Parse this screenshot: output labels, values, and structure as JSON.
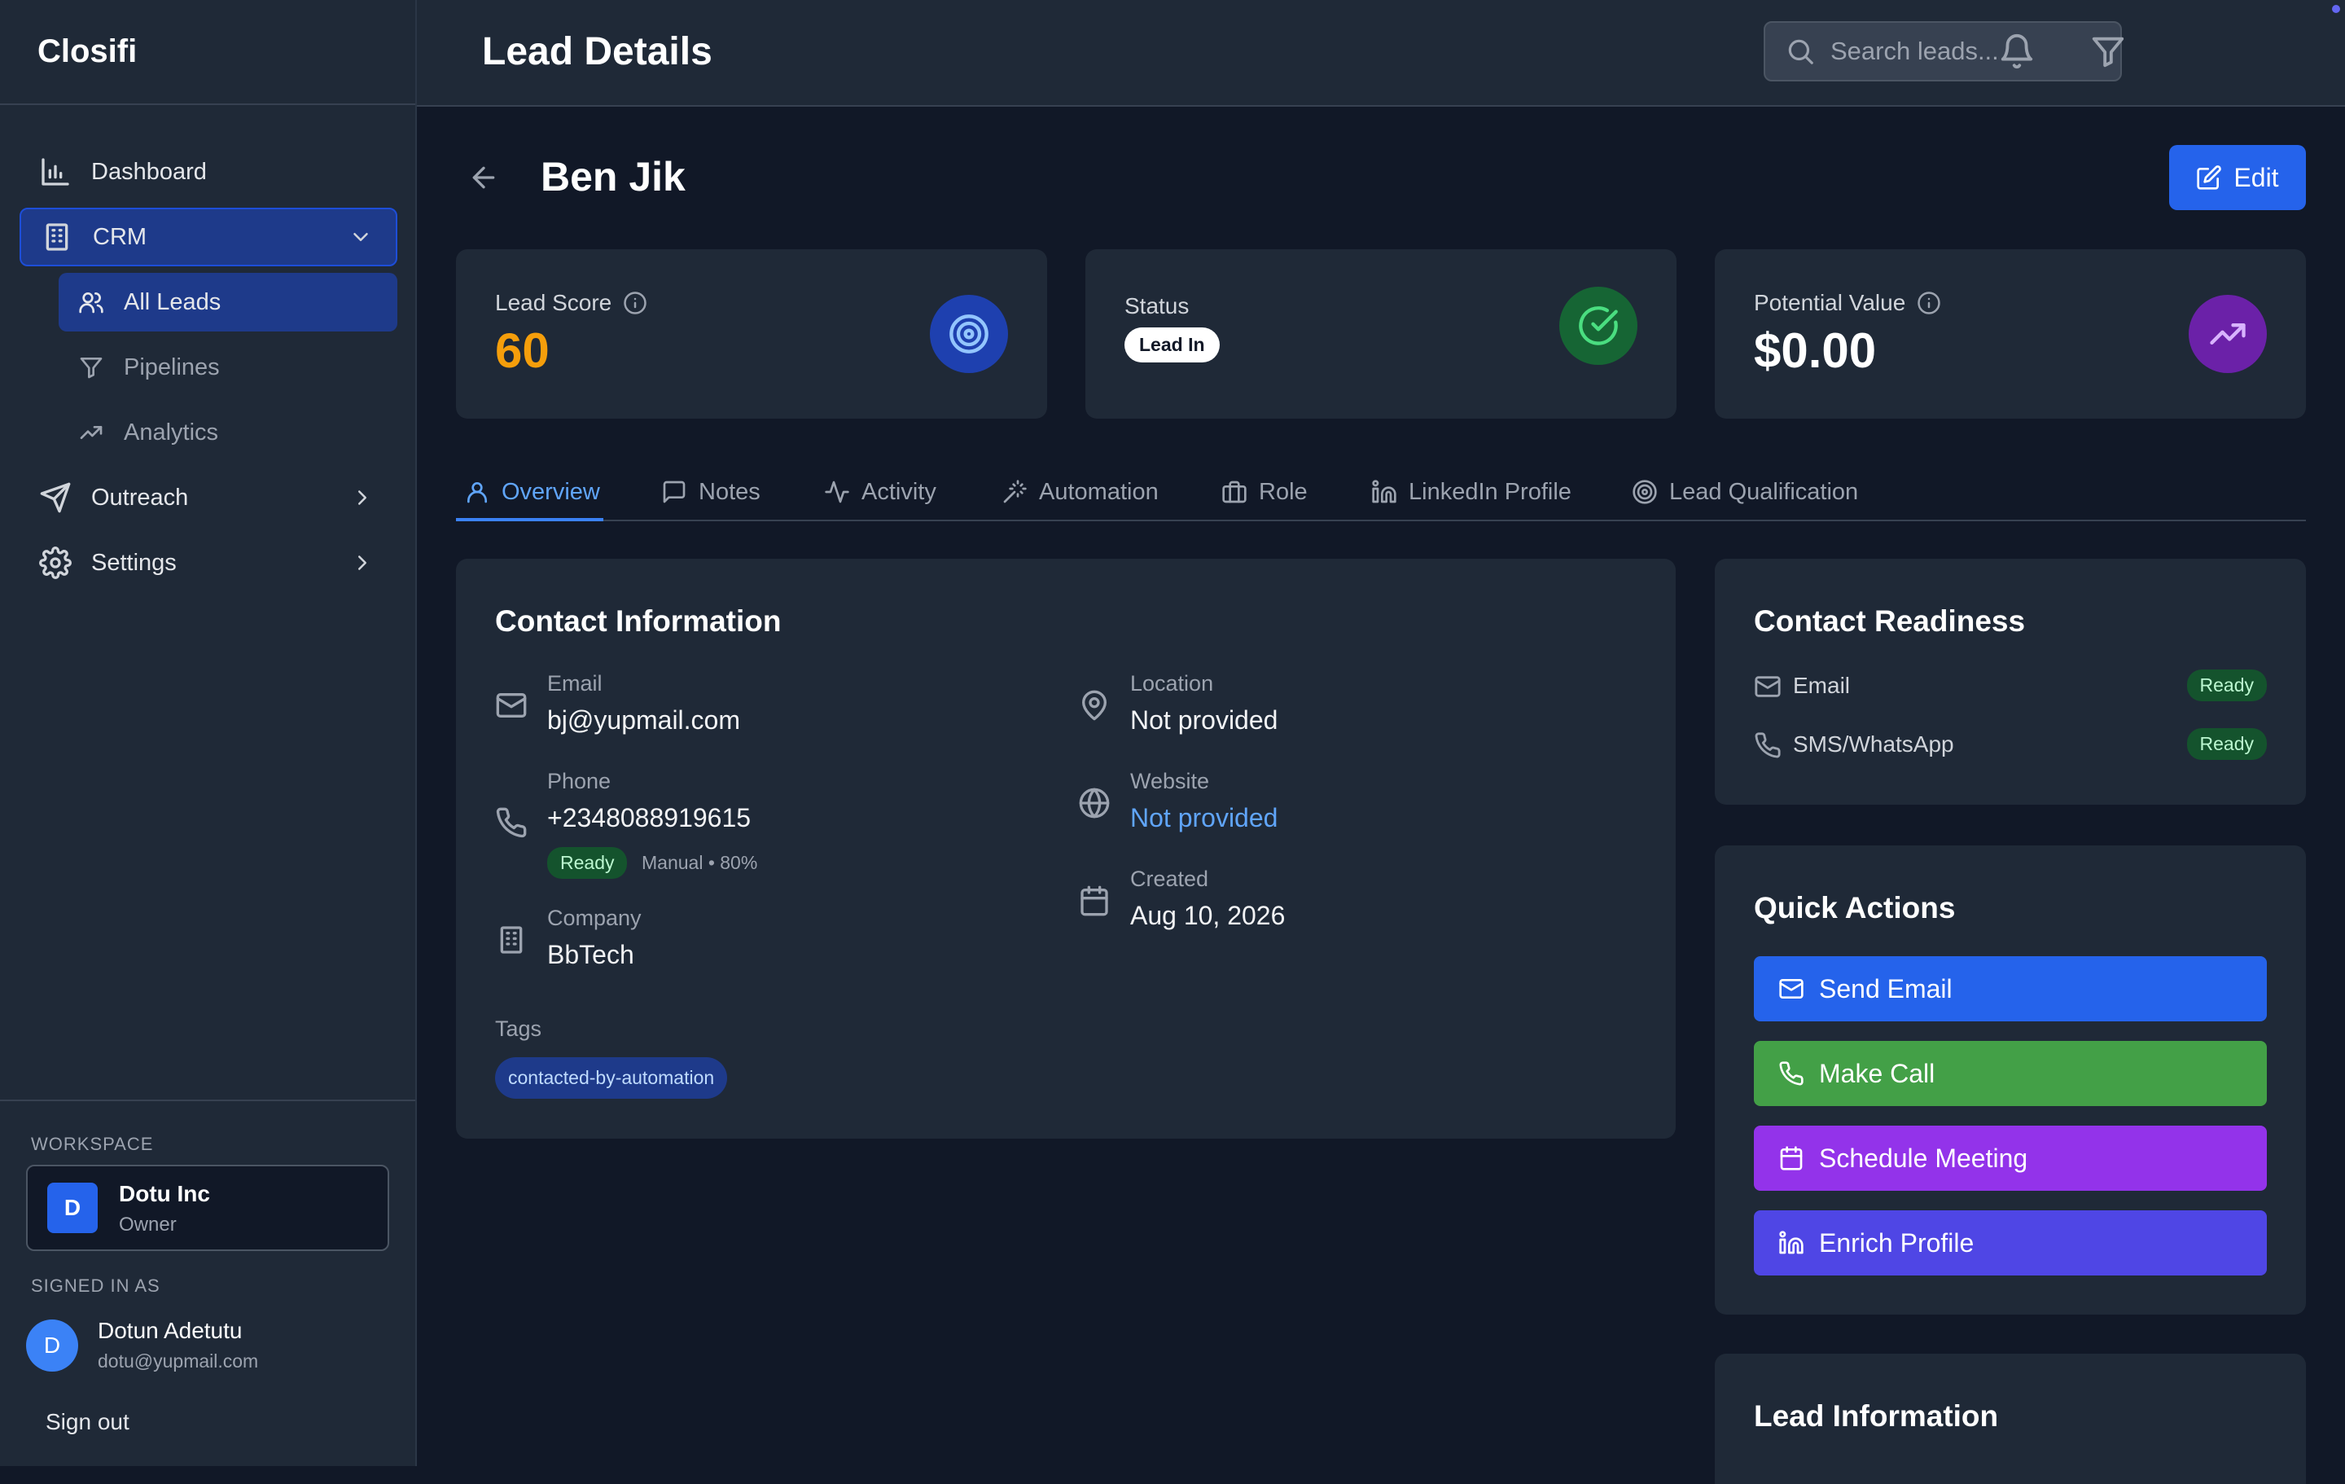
{
  "app": {
    "brand": "Closifi"
  },
  "sidebar": {
    "dashboard": "Dashboard",
    "crm": "CRM",
    "all_leads": "All Leads",
    "pipelines": "Pipelines",
    "analytics": "Analytics",
    "outreach": "Outreach",
    "settings": "Settings",
    "workspace_heading": "WORKSPACE",
    "workspace_initial": "D",
    "workspace_name": "Dotu Inc",
    "workspace_role": "Owner",
    "signed_in_heading": "SIGNED IN AS",
    "user_initial": "D",
    "user_name": "Dotun Adetutu",
    "user_email": "dotu@yupmail.com",
    "sign_out": "Sign out"
  },
  "header": {
    "title": "Lead Details",
    "search_placeholder": "Search leads..."
  },
  "lead": {
    "name": "Ben Jik",
    "edit_label": "Edit"
  },
  "stats": {
    "lead_score_label": "Lead Score",
    "lead_score_value": "60",
    "status_label": "Status",
    "status_value": "Lead In",
    "potential_value_label": "Potential Value",
    "potential_value": "$0.00"
  },
  "tabs": [
    "Overview",
    "Notes",
    "Activity",
    "Automation",
    "Role",
    "LinkedIn Profile",
    "Lead Qualification"
  ],
  "contact": {
    "title": "Contact Information",
    "email_label": "Email",
    "email": "bj@yupmail.com",
    "phone_label": "Phone",
    "phone": "+2348088919615",
    "phone_status": "Ready",
    "phone_meta": "Manual • 80%",
    "company_label": "Company",
    "company": "BbTech",
    "location_label": "Location",
    "location": "Not provided",
    "website_label": "Website",
    "website": "Not provided",
    "created_label": "Created",
    "created": "Aug 10, 2026",
    "tags_label": "Tags",
    "tags": [
      "contacted-by-automation"
    ]
  },
  "readiness": {
    "title": "Contact Readiness",
    "rows": [
      {
        "label": "Email",
        "status": "Ready"
      },
      {
        "label": "SMS/WhatsApp",
        "status": "Ready"
      }
    ]
  },
  "quick_actions": {
    "title": "Quick Actions",
    "send_email": "Send Email",
    "make_call": "Make Call",
    "schedule_meeting": "Schedule Meeting",
    "enrich_profile": "Enrich Profile"
  },
  "lead_information": {
    "title": "Lead Information"
  },
  "colors": {
    "background": "#111827",
    "panel": "#1f2937",
    "accent_blue": "#2563eb",
    "score": "#f59e0b",
    "green_button": "#43a047",
    "purple_button": "#9333ea",
    "indigo_button": "#4f46e5"
  }
}
